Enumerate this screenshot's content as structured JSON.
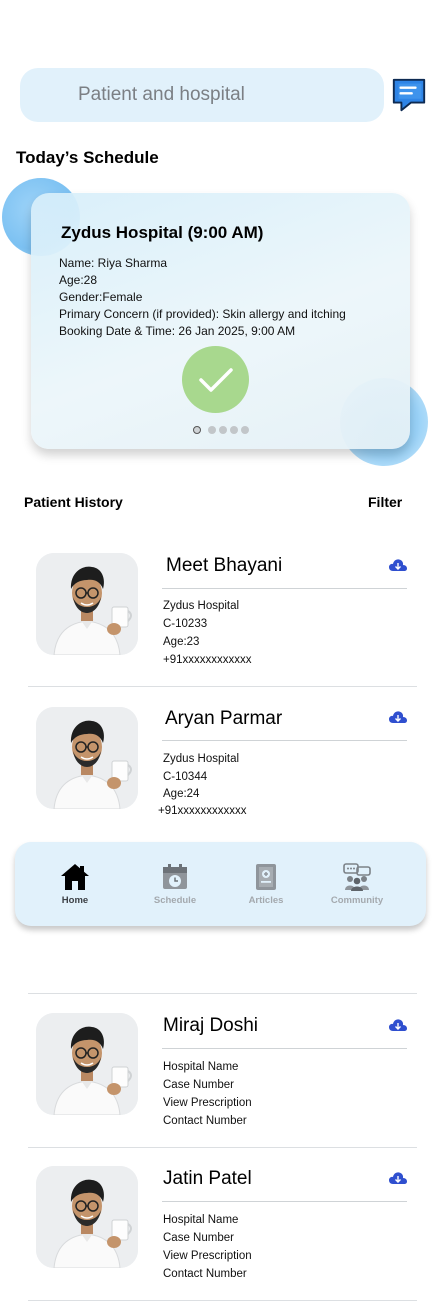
{
  "search": {
    "placeholder": "Patient and hospital"
  },
  "today": {
    "title": "Today’s Schedule",
    "card": {
      "hospital": "Zydus Hospital (9:00 AM)",
      "name": "Name: Riya Sharma",
      "age": "Age:28",
      "gender": "Gender:Female",
      "concern": "Primary Concern (if provided): Skin allergy and itching",
      "booking": "Booking Date & Time: 26 Jan 2025, 9:00 AM"
    },
    "carousel": {
      "page": 1,
      "pages": 5
    }
  },
  "history": {
    "title": "Patient History",
    "filter": "Filter",
    "patients": [
      {
        "name": "Meet Bhayani",
        "lines": [
          "Zydus Hospital",
          "C-10233",
          "Age:23",
          "+91xxxxxxxxxxxx"
        ]
      },
      {
        "name": "Aryan Parmar",
        "lines": [
          "Zydus Hospital",
          "C-10344",
          "Age:24",
          "+91xxxxxxxxxxxx"
        ]
      },
      {
        "name": "Miraj Doshi",
        "lines": [
          "Hospital Name",
          "Case Number",
          "View Prescription",
          "Contact Number"
        ]
      },
      {
        "name": "Jatin Patel",
        "lines": [
          "Hospital Name",
          "Case Number",
          "View Prescription",
          "Contact Number"
        ]
      }
    ]
  },
  "nav": {
    "items": [
      {
        "label": "Home",
        "icon": "home-icon",
        "active": true
      },
      {
        "label": "Schedule",
        "icon": "calendar-icon",
        "active": false
      },
      {
        "label": "Articles",
        "icon": "article-icon",
        "active": false
      },
      {
        "label": "Community",
        "icon": "community-icon",
        "active": false
      }
    ]
  },
  "colors": {
    "accent_bg": "#e1f1fb",
    "success": "#a8d88e",
    "cloud_icon": "#2f4fcf",
    "chat_icon": "#1f6fd6"
  }
}
